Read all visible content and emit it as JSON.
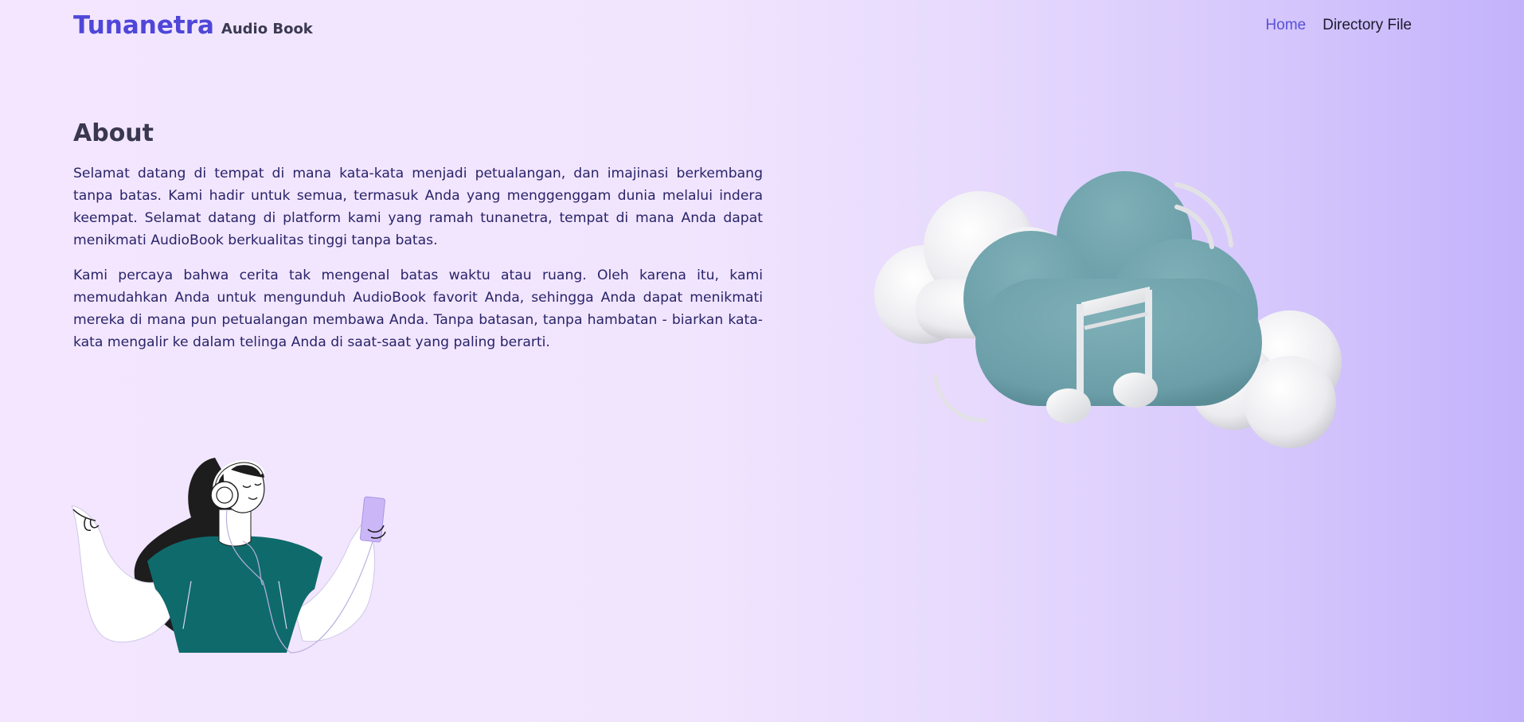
{
  "header": {
    "brand_name": "Tunanetra",
    "brand_sub": "Audio Book",
    "nav": [
      {
        "label": "Home",
        "active": true
      },
      {
        "label": "Directory File",
        "active": false
      }
    ]
  },
  "about": {
    "title": "About",
    "paragraphs": [
      "Selamat datang di tempat di mana kata-kata menjadi petualangan, dan imajinasi berkembang tanpa batas. Kami hadir untuk semua, termasuk Anda yang menggenggam dunia melalui indera keempat. Selamat datang di platform kami yang ramah tunanetra, tempat di mana Anda dapat menikmati AudioBook berkualitas tinggi tanpa batas.",
      "Kami percaya bahwa cerita tak mengenal batas waktu atau ruang. Oleh karena itu, kami memudahkan Anda untuk mengunduh AudioBook favorit Anda, sehingga Anda dapat menikmati mereka di mana pun petualangan membawa Anda. Tanpa batasan, tanpa hambatan - biarkan kata-kata mengalir ke dalam telinga Anda di saat-saat yang paling berarti."
    ]
  },
  "illustrations": {
    "cloud": "music-cloud-illustration",
    "listener": "woman-with-headphones-illustration"
  },
  "colors": {
    "brand": "#4f46d9",
    "nav_active": "#5951d6",
    "text": "#29246a",
    "cloud_teal": "#6fa3ad",
    "shirt_teal": "#0f6a6c"
  }
}
